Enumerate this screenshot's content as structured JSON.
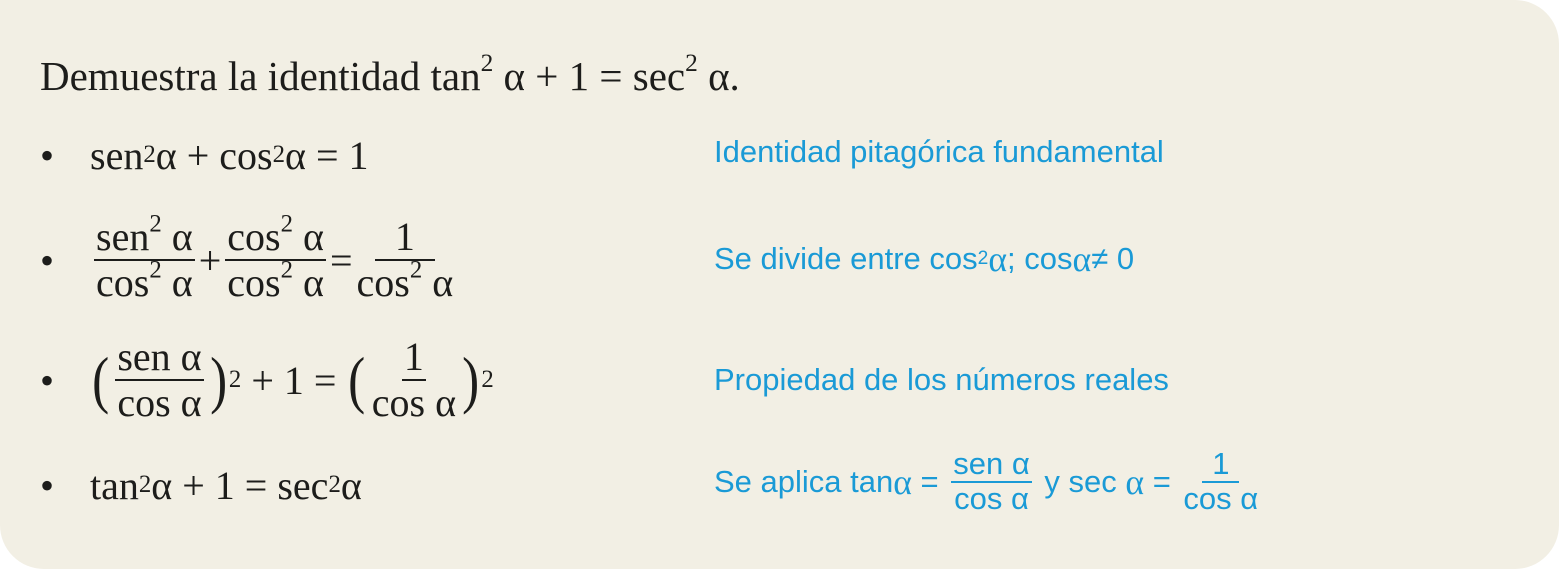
{
  "title": {
    "text": "Demuestra la identidad tan",
    "sup1": "2",
    "mid": " α + 1 = sec",
    "sup2": "2",
    "end": " α."
  },
  "bullet": "•",
  "steps": [
    {
      "math": {
        "a": "sen",
        "s1": "2",
        "b": " α + cos",
        "s2": "2",
        "c": " α = 1"
      },
      "note": "Identidad pitagórica fundamental"
    },
    {
      "math": {
        "n1": "sen",
        "n1s": "2",
        "n1e": " α",
        "d1": "cos",
        "d1s": "2",
        "d1e": " α",
        "plus": "+",
        "n2": "cos",
        "n2s": "2",
        "n2e": " α",
        "d2": "cos",
        "d2s": "2",
        "d2e": " α",
        "eq": "=",
        "n3": "1",
        "d3": "cos",
        "d3s": "2",
        "d3e": " α"
      },
      "note": {
        "a": "Se divide entre cos",
        "s": "2",
        "b": " α",
        "c": "; cos ",
        "d": "α",
        "e": " ≠ 0"
      }
    },
    {
      "math": {
        "lp": "(",
        "n1": "sen α",
        "d1": "cos α",
        "rp": ")",
        "s1": "2",
        "mid": "+ 1 =",
        "lp2": "(",
        "n2": "1",
        "d2": "cos α",
        "rp2": ")",
        "s2": "2"
      },
      "note": "Propiedad de los números reales"
    },
    {
      "math": {
        "a": "tan",
        "s1": "2",
        "b": " α + 1 = sec",
        "s2": "2",
        "c": " α"
      },
      "note": {
        "a": "Se aplica tan ",
        "alpha": "α",
        "eq": " = ",
        "n1": "sen α",
        "d1": "cos α",
        "y": " y sec ",
        "eq2": " = ",
        "n2": "1",
        "d2": "cos α"
      }
    }
  ],
  "colors": {
    "background": "#f2efe4",
    "accent": "#1a9ad6",
    "text": "#1d1d1b"
  }
}
